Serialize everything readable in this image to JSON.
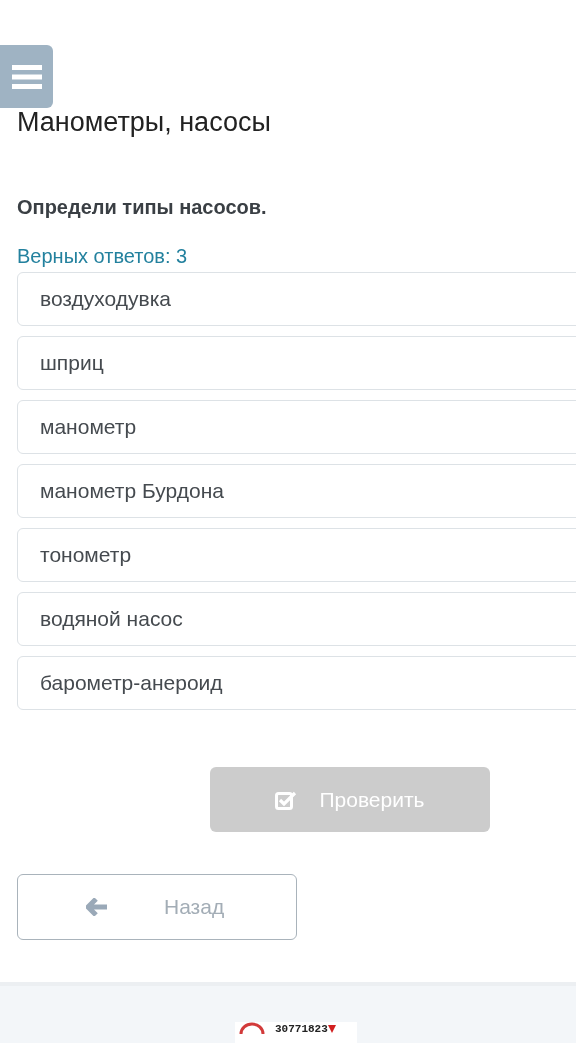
{
  "title": "Манометры, насосы",
  "question": "Определи типы насосов.",
  "correct_count": "Верных ответов: 3",
  "options": [
    {
      "label": "воздуходувка"
    },
    {
      "label": "шприц"
    },
    {
      "label": "манометр"
    },
    {
      "label": "манометр Бурдона"
    },
    {
      "label": "тонометр"
    },
    {
      "label": "водяной насос"
    },
    {
      "label": "барометр-анероид"
    }
  ],
  "check_button": {
    "label": "Проверить",
    "disabled": true
  },
  "back_button": {
    "label": "Назад"
  },
  "counter": {
    "value": "30771823"
  }
}
